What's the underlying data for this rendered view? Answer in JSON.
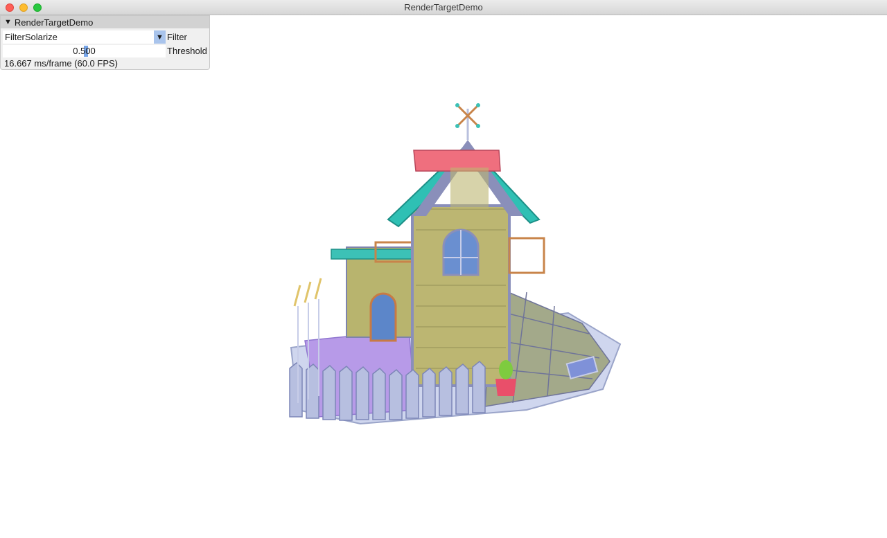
{
  "window": {
    "title": "RenderTargetDemo"
  },
  "gui": {
    "panel_title": "RenderTargetDemo",
    "filter": {
      "selected": "FilterSolarize",
      "label": "Filter"
    },
    "threshold": {
      "value": "0.500",
      "label": "Threshold",
      "fraction": 0.5
    },
    "fps_text": "16.667 ms/frame (60.0 FPS)"
  },
  "icons": [
    "close-icon",
    "minimize-icon",
    "maximize-icon",
    "collapse-triangle-icon",
    "dropdown-arrow-icon"
  ]
}
